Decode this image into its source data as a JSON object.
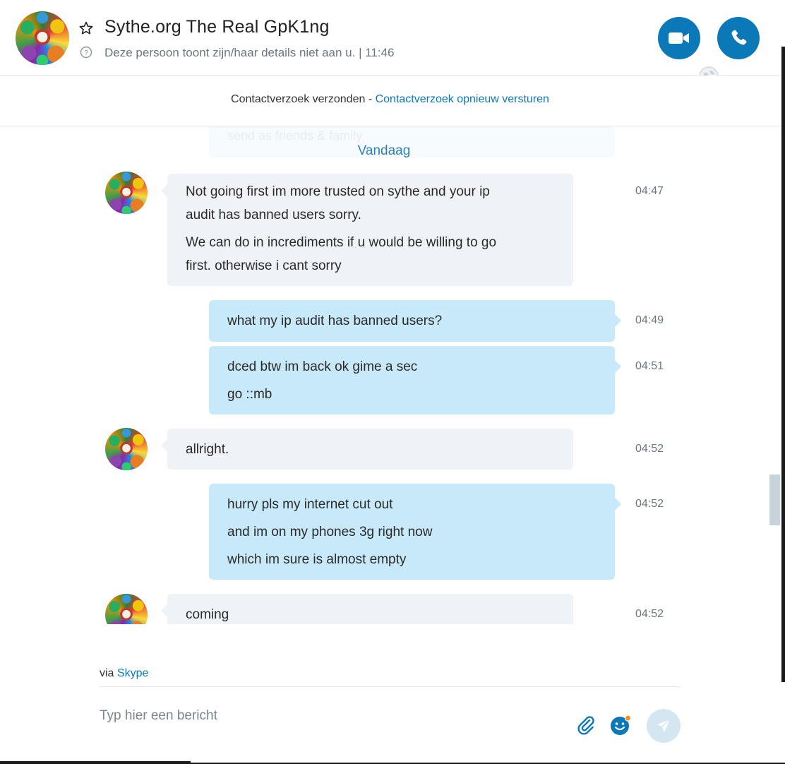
{
  "header": {
    "title": "Sythe.org The Real GpK1ng",
    "subtitle": "Deze persoon toont zijn/haar details niet aan u.  |  11:46"
  },
  "request_bar": {
    "sent_text": "Contactverzoek verzonden - ",
    "resend_link": "Contactverzoek opnieuw versturen"
  },
  "chat": {
    "ghost_text": "send as friends & family",
    "date_label": "Vandaag",
    "messages": [
      {
        "direction": "in",
        "time": "04:47",
        "lines": [
          "Not going first im more trusted on sythe and your ip",
          "audit has banned users sorry.",
          "We can do in incrediments if u would be willing to go",
          "first. otherwise i cant sorry"
        ]
      },
      {
        "direction": "out",
        "time": "04:49",
        "lines": [
          "what my ip audit has banned users?"
        ]
      },
      {
        "direction": "out",
        "time": "04:51",
        "lines": [
          "dced btw im back ok gime a sec",
          "go ::mb"
        ]
      },
      {
        "direction": "in",
        "time": "04:52",
        "lines": [
          "allright."
        ]
      },
      {
        "direction": "out",
        "time": "04:52",
        "lines": [
          "hurry pls my internet cut out",
          "and im on my phones 3g right now",
          "which im sure is almost empty"
        ]
      },
      {
        "direction": "in",
        "time": "04:52",
        "lines": [
          "coming"
        ]
      }
    ]
  },
  "footer": {
    "via_prefix": "via ",
    "via_link": "Skype",
    "compose_placeholder": "Typ hier een bericht"
  },
  "icons": {
    "favorite": "star-outline-icon",
    "info": "question-circle-icon",
    "video": "video-camera-icon",
    "call": "phone-icon",
    "globe": "globe-icon",
    "attach": "paperclip-icon",
    "emoji": "smiley-icon",
    "send": "paper-plane-icon"
  },
  "colors": {
    "accent": "#0b78b7",
    "incoming_bubble": "#eff2f6",
    "outgoing_bubble": "#c7e9f9",
    "send_button": "#d4e7f1",
    "emoji_badge": "#f28c1e"
  }
}
